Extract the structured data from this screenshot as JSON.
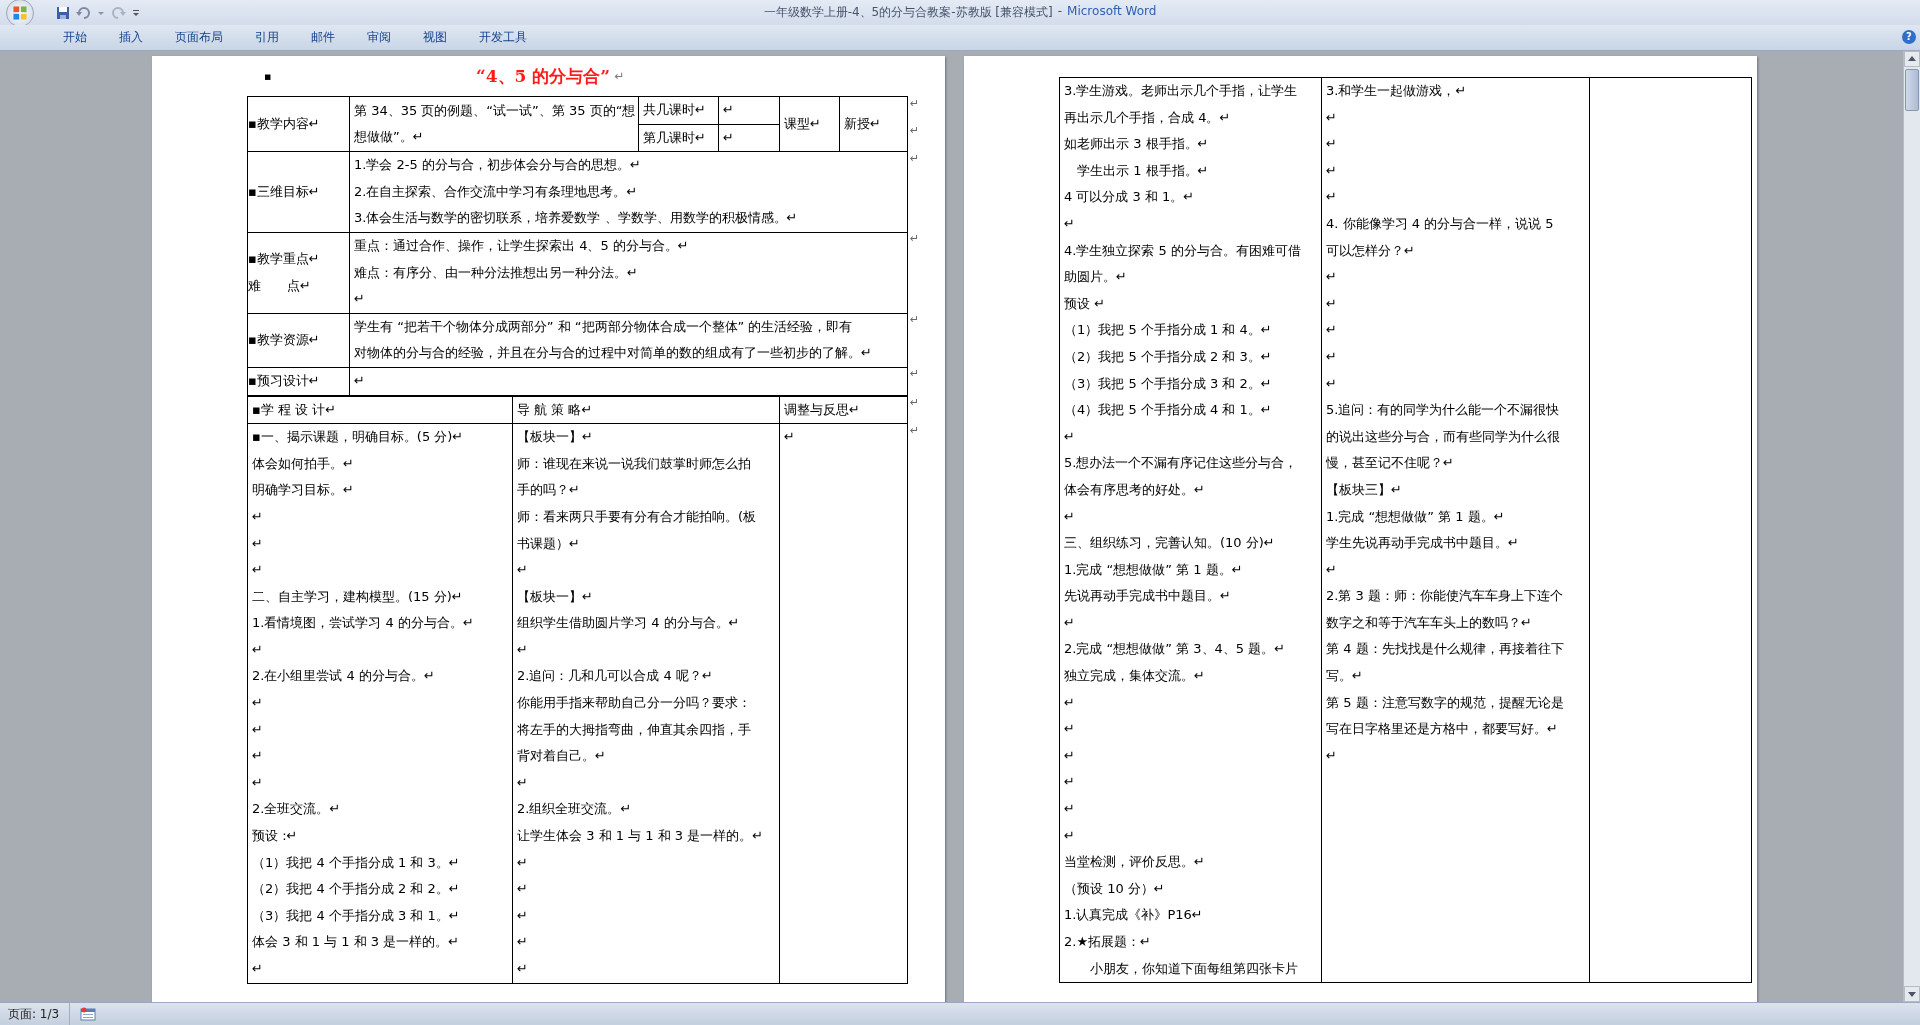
{
  "window": {
    "title": "一年级数学上册-4、5的分与合教案-苏教版 [兼容模式]",
    "separator": "-",
    "app": "Microsoft Word"
  },
  "ribbon_tabs": [
    "开始",
    "插入",
    "页面布局",
    "引用",
    "邮件",
    "审阅",
    "视图",
    "开发工具"
  ],
  "help": "?",
  "page_1": {
    "title": {
      "bullet": "▪",
      "text": "“4、5 的分与合”",
      "mark": "↵"
    },
    "info_table": [
      {
        "label": [
          "▪教学内容↵"
        ],
        "content": [
          "第 34、35 页的例题、“试一试”、第 35 页的“想",
          "想做做”。↵"
        ],
        "periods": [
          {
            "label": "共几课时↵",
            "value": "↵"
          },
          {
            "label": "第几课时↵",
            "value": "↵"
          }
        ],
        "type_label": "课型↵",
        "type_value": "新授↵",
        "end_marks": [
          "↵",
          "↵"
        ]
      },
      {
        "label": [
          "▪三维目标↵"
        ],
        "content": [
          "1.学会 2-5 的分与合，初步体会分与合的思想。↵",
          "2.在自主探索、合作交流中学习有条理地思考。↵",
          "3.体会生活与数学的密切联系，培养爱数学 、学数学、用数学的积极情感。↵"
        ],
        "end_marks": [
          "↵"
        ]
      },
      {
        "label": [
          "▪教学重点↵",
          "难　　点↵"
        ],
        "content": [
          "重点：通过合作、操作，让学生探索出 4、5 的分与合。↵",
          "难点：有序分、由一种分法推想出另一种分法。↵",
          "↵"
        ],
        "end_marks": [
          "↵"
        ]
      },
      {
        "label": [
          "▪教学资源↵"
        ],
        "content": [
          "学生有 “把若干个物体分成两部分” 和 “把两部分物体合成一个整体” 的生活经验，即有",
          "对物体的分与合的经验，并且在分与合的过程中对简单的数的组成有了一些初步的了解。↵"
        ],
        "end_marks": [
          "↵"
        ]
      },
      {
        "label": [
          "▪预习设计↵"
        ],
        "content": [
          "↵"
        ],
        "end_marks": [
          "↵"
        ]
      }
    ],
    "plan_table": {
      "columns": [
        "▪学 程 设 计↵",
        "导 航 策 略↵",
        "调整与反思↵"
      ],
      "header_end_mark": "↵",
      "body_end_mark": "↵",
      "cells": [
        [
          "▪一、揭示课题，明确目标。(5 分)↵",
          "体会如何拍手。↵",
          "明确学习目标。↵",
          "↵",
          "↵",
          "↵",
          "二、自主学习，建构模型。(15 分)↵",
          " 1.看情境图，尝试学习 4 的分与合。↵",
          "↵",
          "2.在小组里尝试 4 的分与合。↵",
          "↵",
          "↵",
          "↵",
          "↵",
          "2.全班交流。↵",
          "预设 :↵",
          "（1）我把 4 个手指分成 1 和 3。↵",
          "（2）我把 4 个手指分成 2 和 2。↵",
          "（3）我把 4 个手指分成 3 和 1。↵",
          "体会 3 和 1 与 1 和 3 是一样的。↵",
          "↵"
        ],
        [
          "【板块一】↵",
          "师：谁现在来说一说我们鼓掌时师怎么拍",
          "手的吗？↵",
          "师：看来两只手要有分有合才能拍响。(板",
          "书课题）↵",
          "↵",
          "【板块一】↵",
          "组织学生借助圆片学习 4 的分与合。↵",
          "↵",
          "2.追问：几和几可以合成 4 呢？↵",
          "你能用手指来帮助自己分一分吗？要求：",
          "将左手的大拇指弯曲，伸直其余四指，手",
          "背对着自己。↵",
          "↵",
          "2.组织全班交流。↵",
          "让学生体会 3 和 1 与 1 和 3 是一样的。↵",
          "↵",
          "↵",
          "↵",
          "↵",
          "↵"
        ],
        [
          "↵"
        ]
      ]
    }
  },
  "page_2": {
    "table_cells": [
      [
        "3.学生游戏。老师出示几个手指，让学生",
        "再出示几个手指，合成 4。↵",
        "如老师出示 3 根手指。↵",
        "　学生出示 1 根手指。↵",
        "4 可以分成 3 和 1。↵",
        "↵",
        "4.学生独立探索 5 的分与合。有困难可借",
        "助圆片。↵",
        "预设 ↵",
        "（1）我把 5 个手指分成 1 和 4。↵",
        "（2）我把 5 个手指分成 2 和 3。↵",
        "（3）我把 5 个手指分成 3 和 2。↵",
        "（4）我把 5 个手指分成 4 和 1。↵",
        "↵",
        "5.想办法一个不漏有序记住这些分与合，",
        "体会有序思考的好处。↵",
        "↵",
        "三、组织练习，完善认知。(10 分)↵",
        " 1.完成 “想想做做” 第 1 题。↵",
        "先说再动手完成书中题目。↵",
        "↵",
        " 2.完成 “想想做做” 第 3、4、5 题。↵",
        "独立完成，集体交流。↵",
        "↵",
        "↵",
        "↵",
        "↵",
        "↵",
        "↵",
        "当堂检测，评价反思。↵",
        "（预设 10 分）↵",
        " 1.认真完成《补》P16↵",
        " 2.★拓展题：↵",
        "　　小朋友，你知道下面每组第四张卡片"
      ],
      [
        "3.和学生一起做游戏，↵",
        "↵",
        "↵",
        "↵",
        "↵",
        "4. 你能像学习 4 的分与合一样，说说 5",
        "可以怎样分？↵",
        "↵",
        "↵",
        "↵",
        "↵",
        "↵",
        "5.追问：有的同学为什么能一个不漏很快",
        "的说出这些分与合，而有些同学为什么很",
        "慢，甚至记不住呢？↵",
        "【板块三】↵",
        " 1.完成 “想想做做” 第 1 题。↵",
        "学生先说再动手完成书中题目。↵",
        "↵",
        "2.第 3 题：师：你能使汽车车身上下连个",
        "数字之和等于汽车车头上的数吗？↵",
        "第 4 题：先找找是什么规律，再接着往下",
        "写。↵",
        "第 5 题：注意写数字的规范，提醒无论是",
        "写在日字格里还是方格中，都要写好。↵",
        "↵"
      ],
      []
    ]
  },
  "status_bar": {
    "page": "页面: 1/3"
  }
}
